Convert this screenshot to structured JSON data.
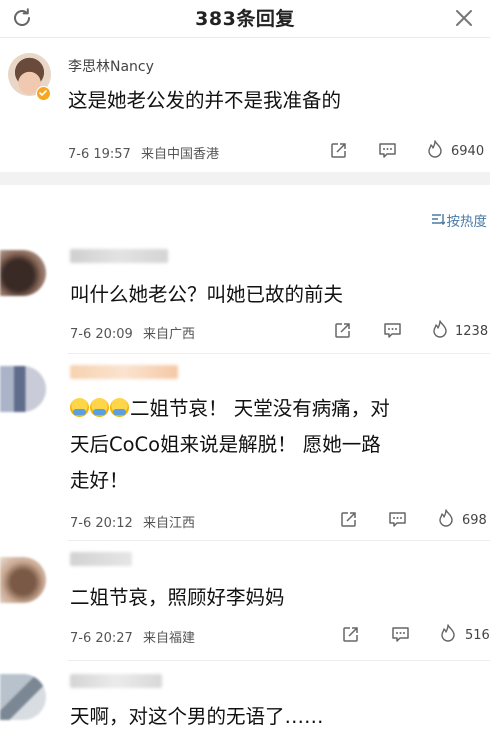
{
  "header": {
    "title": "383条回复",
    "refresh_icon": "refresh-icon",
    "close_icon": "close-icon"
  },
  "root_comment": {
    "author": "李思林Nancy",
    "verified_badge": "verified-badge-icon",
    "text": "这是她老公发的并不是我准备的",
    "time": "7-6 19:57",
    "source": "来自中国香港",
    "likes": "6940"
  },
  "sort": {
    "label": "按热度"
  },
  "comments": [
    {
      "text_lines": [
        "叫什么她老公？叫她已故的前夫"
      ],
      "time": "7-6 20:09",
      "source": "来自广西",
      "likes": "1238"
    },
    {
      "text_lines": [
        "二姐节哀！ 天堂没有病痛，对",
        "天后CoCo姐来说是解脱！ 愿她一路",
        "走好！"
      ],
      "time": "7-6 20:12",
      "source": "来自江西",
      "likes": "698"
    },
    {
      "text_lines": [
        "二姐节哀，照顾好李妈妈"
      ],
      "time": "7-6 20:27",
      "source": "来自福建",
      "likes": "516"
    },
    {
      "text_lines": [
        "天啊，对这个男的无语了……"
      ]
    }
  ],
  "colors": {
    "sort_link": "#4a7aa6",
    "badge": "#f5a623",
    "divider": "#f2f2f2"
  }
}
